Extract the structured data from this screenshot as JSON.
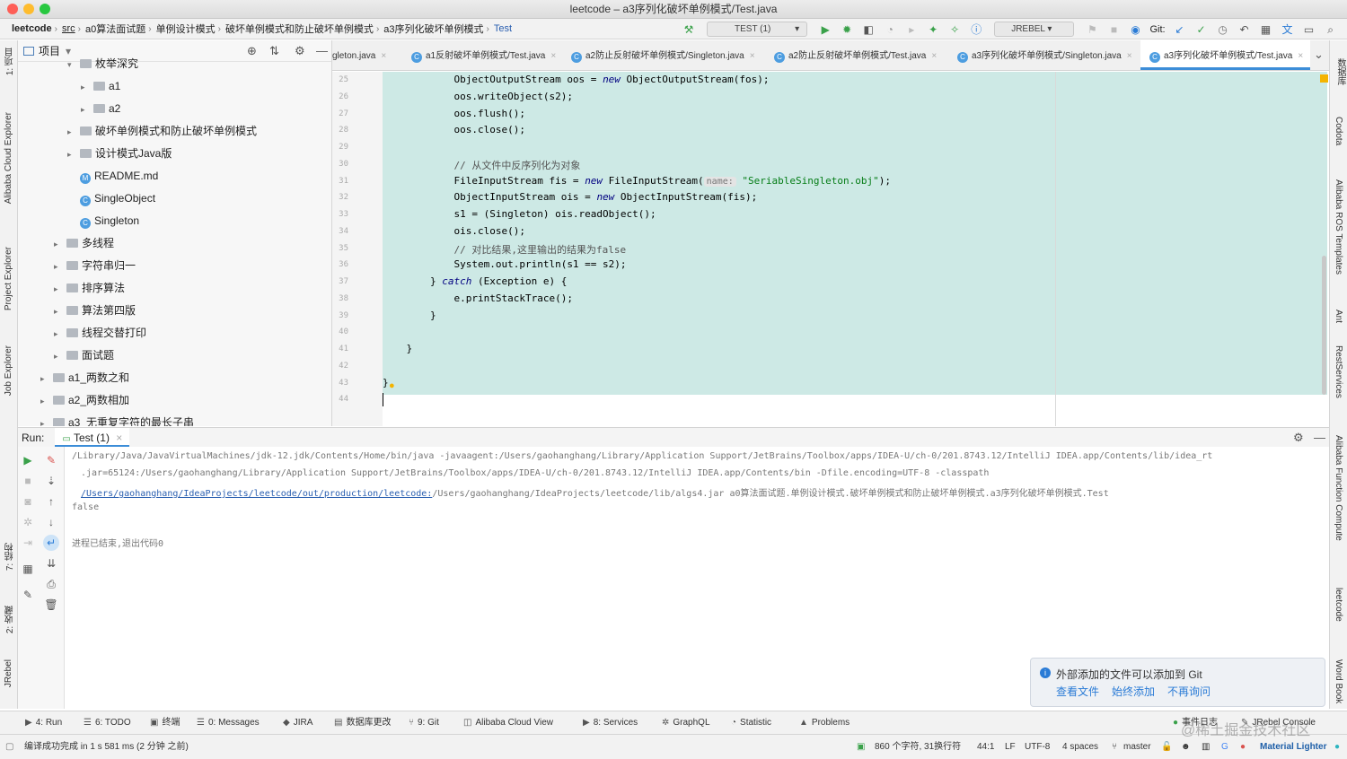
{
  "window": {
    "title": "leetcode – a3序列化破坏单例模式/Test.java"
  },
  "breadcrumbs": [
    "leetcode",
    "src",
    "a0算法面试题",
    "单例设计模式",
    "破坏单例模式和防止破坏单例模式",
    "a3序列化破坏单例模式",
    "Test"
  ],
  "toolbar": {
    "run_config": "TEST (1)",
    "jrebel": "JREBEL",
    "git_label": "Git:"
  },
  "left_stripe": {
    "project": "1: 项目",
    "alibaba_cloud": "Alibaba Cloud Explorer",
    "project_explorer": "Project Explorer",
    "job_explorer": "Job Explorer",
    "structure": "7: 结构",
    "favorites": "2: 收藏",
    "jrebel": "JRebel"
  },
  "right_stripe": {
    "database": "数据库",
    "codota": "Codota",
    "ros": "Alibaba ROS Templates",
    "ant": "Ant",
    "rest": "RestServices",
    "function": "Alibaba Function Compute",
    "leetcode": "leetcode",
    "wordbook": "Word Book"
  },
  "project_panel": {
    "title": "项目",
    "items": [
      {
        "label": "枚举深究",
        "type": "folder",
        "depth": 3,
        "arrow": "▾"
      },
      {
        "label": "a1",
        "type": "folder",
        "depth": 4,
        "arrow": "▸"
      },
      {
        "label": "a2",
        "type": "folder",
        "depth": 4,
        "arrow": "▸"
      },
      {
        "label": "破坏单例模式和防止破坏单例模式",
        "type": "folder",
        "depth": 3,
        "arrow": "▸"
      },
      {
        "label": "设计模式Java版",
        "type": "folder",
        "depth": 3,
        "arrow": "▸"
      },
      {
        "label": "README.md",
        "type": "md",
        "depth": 3,
        "arrow": ""
      },
      {
        "label": "SingleObject",
        "type": "class",
        "depth": 3,
        "arrow": ""
      },
      {
        "label": "Singleton",
        "type": "class",
        "depth": 3,
        "arrow": ""
      },
      {
        "label": "多线程",
        "type": "folder",
        "depth": 2,
        "arrow": "▸"
      },
      {
        "label": "字符串归一",
        "type": "folder",
        "depth": 2,
        "arrow": "▸"
      },
      {
        "label": "排序算法",
        "type": "folder",
        "depth": 2,
        "arrow": "▸"
      },
      {
        "label": "算法第四版",
        "type": "folder",
        "depth": 2,
        "arrow": "▸"
      },
      {
        "label": "线程交替打印",
        "type": "folder",
        "depth": 2,
        "arrow": "▸"
      },
      {
        "label": "面试题",
        "type": "folder",
        "depth": 2,
        "arrow": "▸"
      },
      {
        "label": "a1_两数之和",
        "type": "folder",
        "depth": 1,
        "arrow": "▸"
      },
      {
        "label": "a2_两数相加",
        "type": "folder",
        "depth": 1,
        "arrow": "▸"
      },
      {
        "label": "a3_无重复字符的最长子串",
        "type": "folder",
        "depth": 1,
        "arrow": "▸"
      }
    ]
  },
  "tabs": [
    {
      "label": "gleton.java"
    },
    {
      "label": "a1反射破坏单例模式/Test.java"
    },
    {
      "label": "a2防止反射破坏单例模式/Singleton.java"
    },
    {
      "label": "a2防止反射破坏单例模式/Test.java"
    },
    {
      "label": "a3序列化破坏单例模式/Singleton.java"
    },
    {
      "label": "a3序列化破坏单例模式/Test.java",
      "active": true
    }
  ],
  "editor": {
    "line_numbers": [
      "25",
      "26",
      "27",
      "28",
      "29",
      "30",
      "31",
      "32",
      "33",
      "34",
      "35",
      "36",
      "37",
      "38",
      "39",
      "40",
      "41",
      "42",
      "43",
      "44"
    ],
    "lines": [
      {
        "indent": "            ",
        "plain": "ObjectOutputStream oos = ",
        "kw": "new",
        "rest": " ObjectOutputStream(fos);"
      },
      {
        "indent": "            ",
        "plain": "oos.writeObject(s2);",
        "kw": "",
        "rest": ""
      },
      {
        "indent": "            ",
        "plain": "oos.flush();",
        "kw": "",
        "rest": ""
      },
      {
        "indent": "            ",
        "plain": "oos.close();",
        "kw": "",
        "rest": ""
      },
      {
        "indent": "",
        "plain": "",
        "kw": "",
        "rest": ""
      },
      {
        "indent": "            ",
        "plain": "// 从文件中反序列化为对象",
        "kw": "",
        "rest": "",
        "comment": true
      },
      {
        "indent": "            ",
        "plain": "FileInputStream fis = ",
        "kw": "new",
        "rest": " FileInputStream(",
        "hint": "name:",
        "str": "\"SeriableSingleton.obj\"",
        "tail": ");"
      },
      {
        "indent": "            ",
        "plain": "ObjectInputStream ois = ",
        "kw": "new",
        "rest": " ObjectInputStream(fis);"
      },
      {
        "indent": "            ",
        "plain": "s1 = (Singleton) ois.readObject();",
        "kw": "",
        "rest": ""
      },
      {
        "indent": "            ",
        "plain": "ois.close();",
        "kw": "",
        "rest": ""
      },
      {
        "indent": "            ",
        "plain": "// 对比结果,这里输出的结果为false",
        "kw": "",
        "rest": "",
        "comment": true
      },
      {
        "indent": "            ",
        "plain": "System.out.println(s1 == s2);",
        "kw": "",
        "rest": ""
      },
      {
        "indent": "        ",
        "plain": "} ",
        "kw": "catch",
        "rest": " (Exception e) {"
      },
      {
        "indent": "            ",
        "plain": "e.printStackTrace();",
        "kw": "",
        "rest": ""
      },
      {
        "indent": "        ",
        "plain": "}",
        "kw": "",
        "rest": ""
      },
      {
        "indent": "",
        "plain": "",
        "kw": "",
        "rest": ""
      },
      {
        "indent": "    ",
        "plain": "}",
        "kw": "",
        "rest": ""
      },
      {
        "indent": "",
        "plain": "",
        "kw": "",
        "rest": ""
      },
      {
        "indent": "",
        "plain": "}",
        "kw": "",
        "rest": ""
      },
      {
        "indent": "",
        "plain": "",
        "kw": "",
        "rest": ""
      }
    ]
  },
  "run_panel": {
    "label": "Run:",
    "tab": "Test (1)",
    "console": [
      "/Library/Java/JavaVirtualMachines/jdk-12.jdk/Contents/Home/bin/java -javaagent:/Users/gaohanghang/Library/Application Support/JetBrains/Toolbox/apps/IDEA-U/ch-0/201.8743.12/IntelliJ IDEA.app/Contents/lib/idea_rt",
      ".jar=65124:/Users/gaohanghang/Library/Application Support/JetBrains/Toolbox/apps/IDEA-U/ch-0/201.8743.12/IntelliJ IDEA.app/Contents/bin -Dfile.encoding=UTF-8 -classpath",
      "/Users/gaohanghang/IdeaProjects/leetcode/out/production/leetcode:",
      "/Users/gaohanghang/IdeaProjects/leetcode/lib/algs4.jar a0算法面试题.单例设计模式.破坏单例模式和防止破坏单例模式.a3序列化破坏单例模式.Test",
      "false",
      "进程已结束,退出代码0"
    ]
  },
  "notification": {
    "message": "外部添加的文件可以添加到 Git",
    "actions": [
      "查看文件",
      "始终添加",
      "不再询问"
    ]
  },
  "tool_windows": [
    {
      "label": "4: Run",
      "icon": "▶"
    },
    {
      "label": "6: TODO",
      "icon": "☰"
    },
    {
      "label": "终端",
      "icon": "▣"
    },
    {
      "label": "0: Messages",
      "icon": "☰"
    },
    {
      "label": "JIRA",
      "icon": "◆"
    },
    {
      "label": "数据库更改",
      "icon": "▤"
    },
    {
      "label": "9: Git",
      "icon": "⑂"
    },
    {
      "label": "Alibaba Cloud View",
      "icon": "◫"
    },
    {
      "label": "8: Services",
      "icon": "▶"
    },
    {
      "label": "GraphQL",
      "icon": "✲"
    },
    {
      "label": "Statistic",
      "icon": "◔"
    },
    {
      "label": "Problems",
      "icon": "▲"
    }
  ],
  "tool_windows_right": [
    {
      "label": "事件日志",
      "icon": "●"
    },
    {
      "label": "JRebel Console",
      "icon": "✎"
    }
  ],
  "status": {
    "message": "编译成功完成 in 1 s 581 ms (2 分钟 之前)",
    "chars": "860 个字符, 31换行符",
    "position": "44:1",
    "line_sep": "LF",
    "encoding": "UTF-8",
    "indent": "4 spaces",
    "branch": "master",
    "theme": "Material Lighter"
  },
  "watermark": "@稀土掘金技术社区",
  "colors": {
    "accent": "#3c8dd8",
    "highlight": "#cde9e5",
    "run_green": "#3aa14a"
  }
}
